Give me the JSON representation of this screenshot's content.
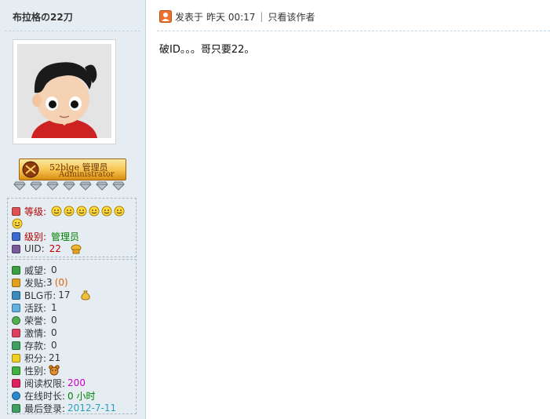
{
  "author": {
    "username": "布拉格の22刀"
  },
  "rank_badge": {
    "line1": "52blge 管理员",
    "line2": "Administrator"
  },
  "profile": {
    "level_label": "等级:",
    "group_label": "级别:",
    "group_value": "管理员",
    "uid_label": "UID:",
    "uid_value": "22",
    "stats": [
      {
        "label": "威望:",
        "value": "0"
      },
      {
        "label": "发贴:",
        "value": "3",
        "extra": "(0)"
      },
      {
        "label": "BLG币:",
        "value": "17"
      },
      {
        "label": "活跃:",
        "value": "1"
      },
      {
        "label": "荣誉:",
        "value": "0"
      },
      {
        "label": "激情:",
        "value": "0"
      },
      {
        "label": "存款:",
        "value": "0"
      },
      {
        "label": "积分:",
        "value": "21"
      },
      {
        "label": "性别:",
        "value": ""
      },
      {
        "label": "阅读权限:",
        "value": "200"
      },
      {
        "label": "在线时长:",
        "value": "0 小时"
      },
      {
        "label": "最后登录:",
        "value": "2012-7-11"
      }
    ]
  },
  "post": {
    "posted_prefix": "发表于",
    "posted_time": "昨天 00:17",
    "only_author": "只看该作者",
    "body": "破ID。。。哥只要22。"
  },
  "colors": {
    "sidebar_bg": "#e5edf2",
    "border": "#c2d5e3",
    "admin_green": "#008000",
    "uid_red": "#c00000"
  }
}
